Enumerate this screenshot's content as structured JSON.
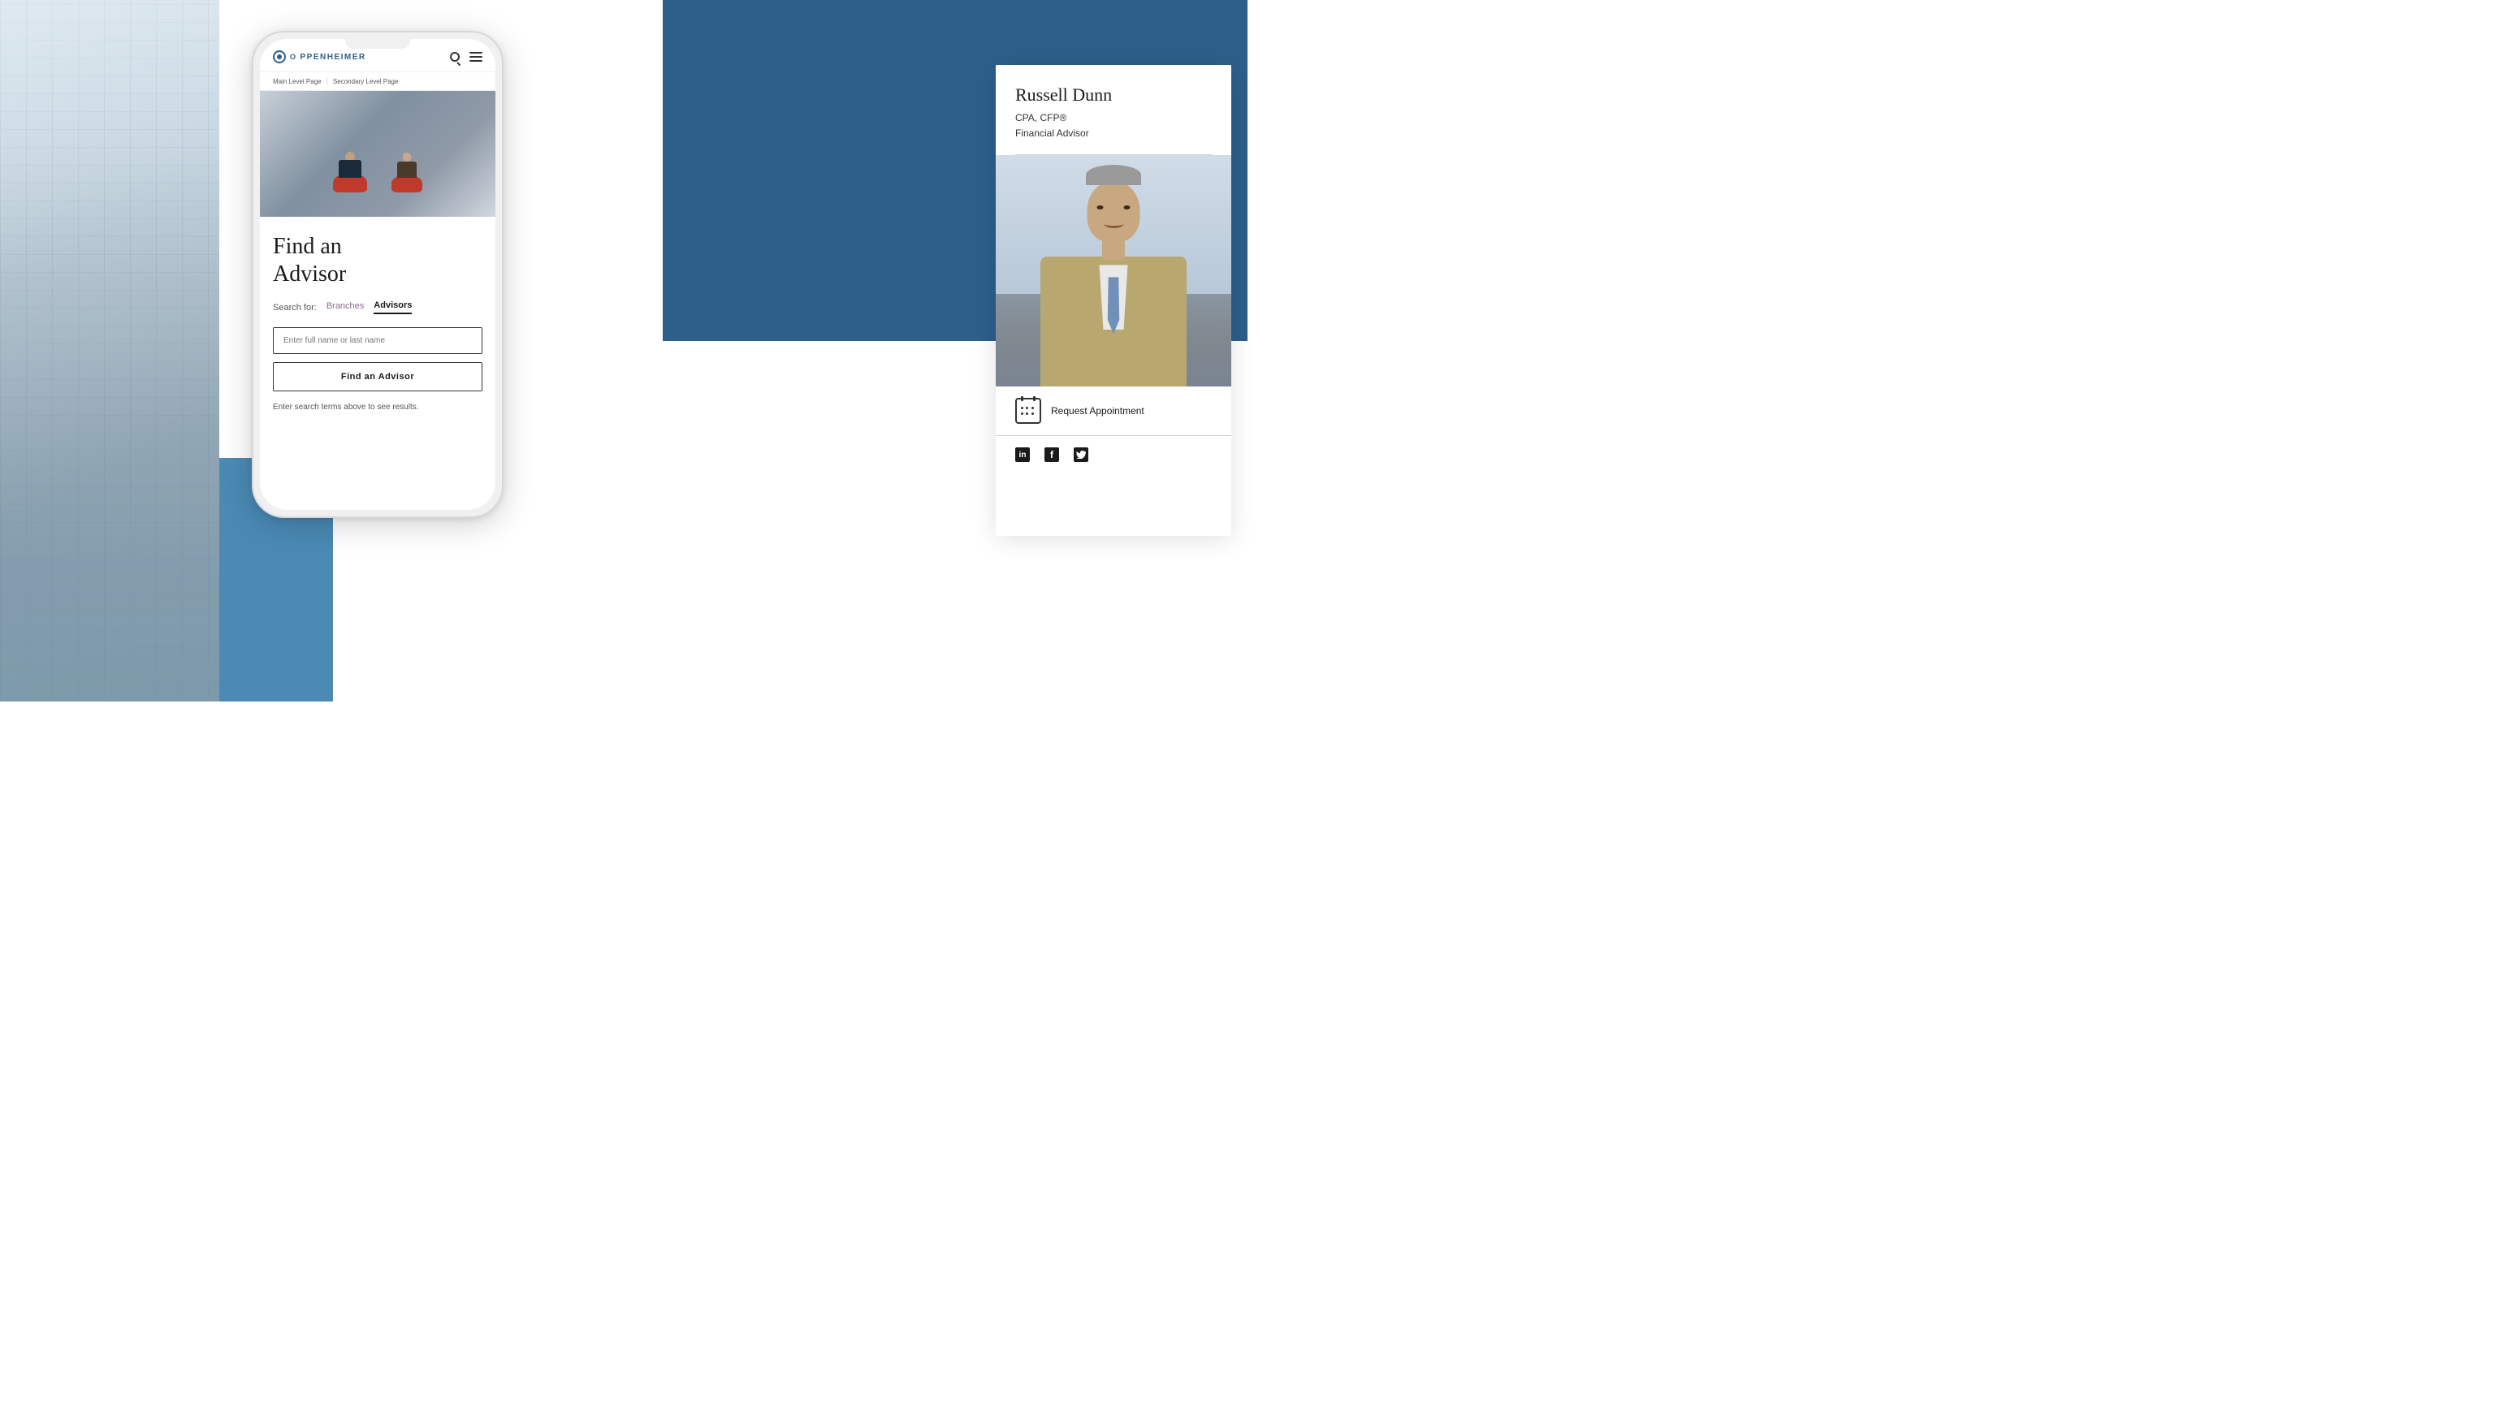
{
  "page": {
    "title": "Find an Advisor - Oppenheimer",
    "background": {
      "top_blue": "#2c5f8a",
      "bottom_blue": "#4a8ab5"
    }
  },
  "phone": {
    "logo": {
      "text": "PPENHEIMER",
      "prefix": "O"
    },
    "breadcrumb": {
      "main": "Main Level Page",
      "secondary": "Secondary Level Page",
      "separator": "|"
    },
    "find_advisor": {
      "title_line1": "Find an",
      "title_line2": "Advisor",
      "search_for_label": "Search for:",
      "tab_branches": "Branches",
      "tab_advisors": "Advisors",
      "input_placeholder": "Enter full name or last name",
      "button_label": "Find an Advisor",
      "hint_text": "Enter search terms above to see results."
    }
  },
  "advisor_card": {
    "name": "Russell Dunn",
    "credentials_line1": "CPA, CFP®",
    "credentials_line2": "Financial Advisor",
    "appointment_label": "Request Appointment",
    "social": {
      "linkedin": "in",
      "facebook": "f",
      "twitter": "t"
    }
  }
}
